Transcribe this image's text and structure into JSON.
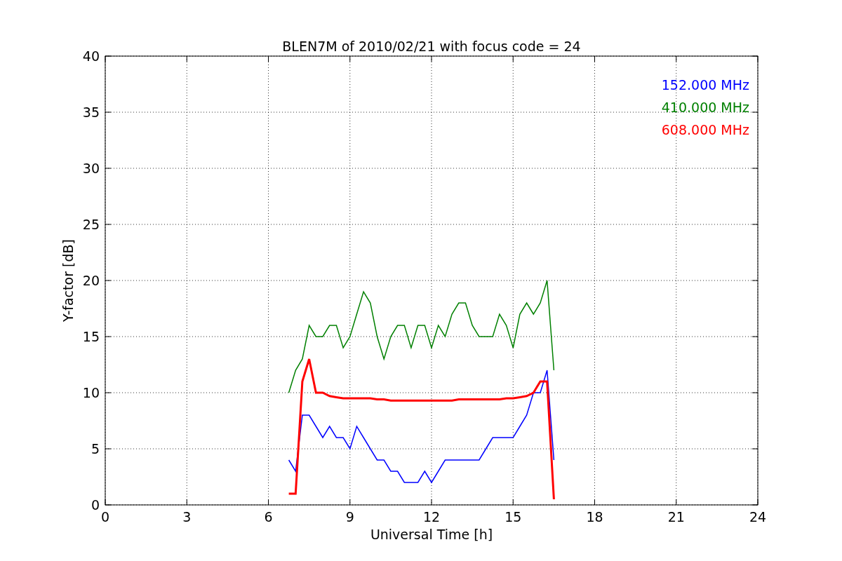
{
  "chart_data": {
    "type": "line",
    "title": "BLEN7M of 2010/02/21 with focus code = 24",
    "xlabel": "Universal Time [h]",
    "ylabel": "Y-factor [dB]",
    "x": [
      6.75,
      7,
      7.25,
      7.5,
      7.75,
      8,
      8.25,
      8.5,
      8.75,
      9,
      9.25,
      9.5,
      9.75,
      10,
      10.25,
      10.5,
      10.75,
      11,
      11.25,
      11.5,
      11.75,
      12,
      12.25,
      12.5,
      12.75,
      13,
      13.25,
      13.5,
      13.75,
      14,
      14.25,
      14.5,
      14.75,
      15,
      15.25,
      15.5,
      15.75,
      16,
      16.25,
      16.5
    ],
    "series": [
      {
        "name": "152.000 MHz",
        "color": "#0000ff",
        "values": [
          4,
          3,
          8,
          8,
          7,
          6,
          7,
          6,
          6,
          5,
          7,
          6,
          5,
          4,
          4,
          3,
          3,
          2,
          2,
          2,
          3,
          2,
          3,
          4,
          4,
          4,
          4,
          4,
          4,
          5,
          6,
          6,
          6,
          6,
          7,
          8,
          10,
          10,
          12,
          4
        ]
      },
      {
        "name": "410.000 MHz",
        "color": "#008000",
        "values": [
          10,
          12,
          13,
          16,
          15,
          15,
          16,
          16,
          14,
          15,
          17,
          19,
          18,
          15,
          13,
          15,
          16,
          16,
          14,
          16,
          16,
          14,
          16,
          15,
          17,
          18,
          18,
          16,
          15,
          15,
          15,
          17,
          16,
          14,
          17,
          18,
          17,
          18,
          20,
          12
        ]
      },
      {
        "name": "608.000 MHz",
        "color": "#ff0000",
        "values": [
          1,
          1,
          11,
          13,
          10,
          10,
          9.7,
          9.6,
          9.5,
          9.5,
          9.5,
          9.5,
          9.5,
          9.4,
          9.4,
          9.3,
          9.3,
          9.3,
          9.3,
          9.3,
          9.3,
          9.3,
          9.3,
          9.3,
          9.3,
          9.4,
          9.4,
          9.4,
          9.4,
          9.4,
          9.4,
          9.4,
          9.5,
          9.5,
          9.6,
          9.7,
          10,
          11,
          11,
          0.5
        ]
      }
    ],
    "grid": true,
    "xlim": [
      0,
      24
    ],
    "ylim": [
      0,
      40
    ],
    "xticks": [
      0,
      3,
      6,
      9,
      12,
      15,
      18,
      21,
      24
    ],
    "yticks": [
      0,
      5,
      10,
      15,
      20,
      25,
      30,
      35,
      40
    ]
  }
}
